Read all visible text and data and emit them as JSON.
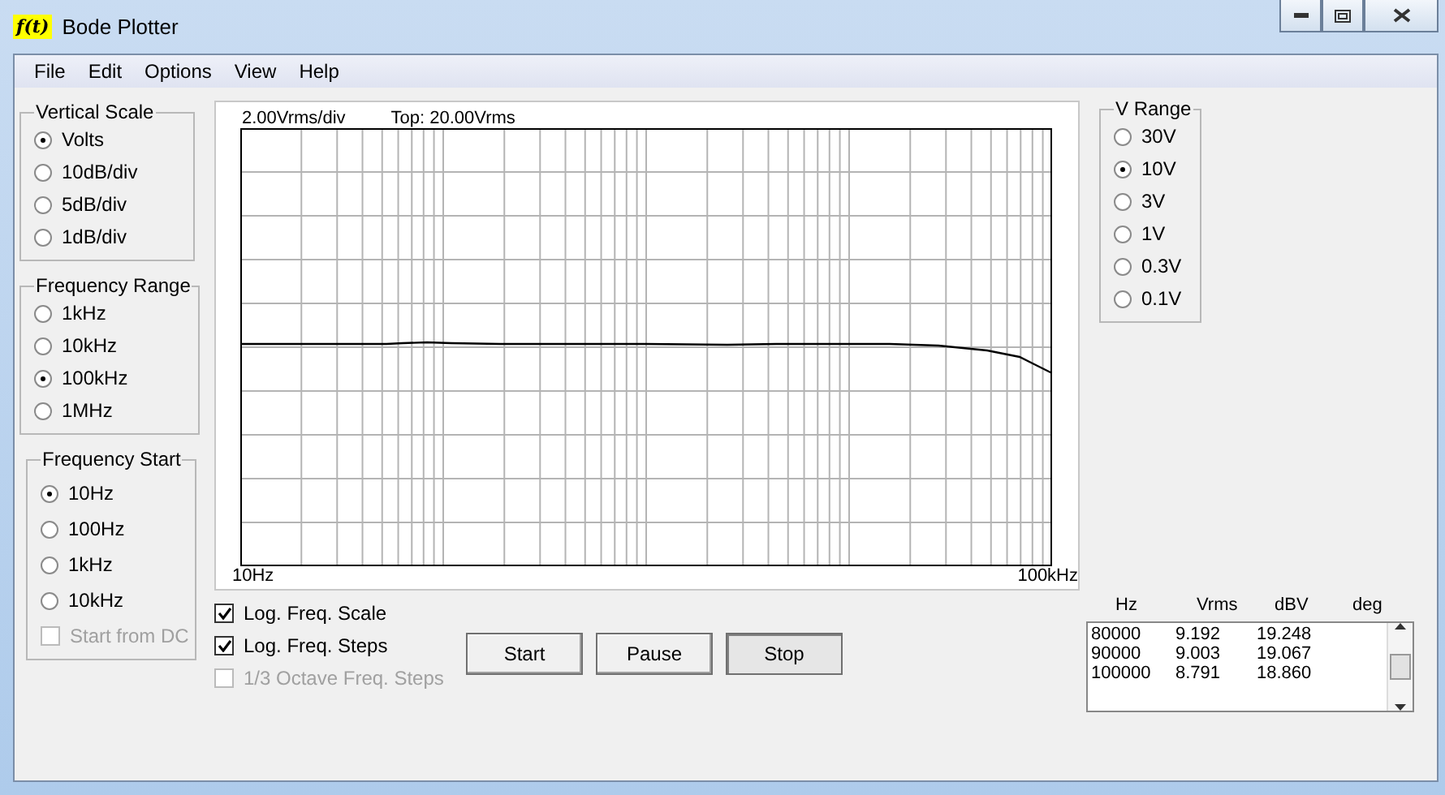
{
  "window": {
    "logo": "f(t)",
    "title": "Bode Plotter"
  },
  "menu": [
    "File",
    "Edit",
    "Options",
    "View",
    "Help"
  ],
  "vertical_scale": {
    "title": "Vertical Scale",
    "options": [
      {
        "label": "Volts",
        "selected": true
      },
      {
        "label": "10dB/div",
        "selected": false
      },
      {
        "label": "5dB/div",
        "selected": false
      },
      {
        "label": "1dB/div",
        "selected": false
      }
    ]
  },
  "frequency_range": {
    "title": "Frequency Range",
    "options": [
      {
        "label": "1kHz",
        "selected": false
      },
      {
        "label": "10kHz",
        "selected": false
      },
      {
        "label": "100kHz",
        "selected": true
      },
      {
        "label": "1MHz",
        "selected": false
      }
    ]
  },
  "frequency_start": {
    "title": "Frequency Start",
    "options": [
      {
        "label": "10Hz",
        "selected": true
      },
      {
        "label": "100Hz",
        "selected": false
      },
      {
        "label": "1kHz",
        "selected": false
      },
      {
        "label": "10kHz",
        "selected": false
      }
    ],
    "start_from_dc": {
      "label": "Start from DC",
      "checked": false,
      "disabled": true
    }
  },
  "plot": {
    "scale_label": "2.00Vrms/div",
    "top_label": "Top: 20.00Vrms",
    "x_start": "10Hz",
    "x_end": "100kHz"
  },
  "v_range": {
    "title": "V Range",
    "options": [
      {
        "label": "30V",
        "selected": false
      },
      {
        "label": "10V",
        "selected": true
      },
      {
        "label": "3V",
        "selected": false
      },
      {
        "label": "1V",
        "selected": false
      },
      {
        "label": "0.3V",
        "selected": false
      },
      {
        "label": "0.1V",
        "selected": false
      }
    ]
  },
  "checkboxes": [
    {
      "label": "Log. Freq. Scale",
      "checked": true,
      "disabled": false
    },
    {
      "label": "Log. Freq. Steps",
      "checked": true,
      "disabled": false
    },
    {
      "label": "1/3 Octave Freq. Steps",
      "checked": false,
      "disabled": true
    }
  ],
  "buttons": [
    {
      "label": "Start",
      "pressed": false
    },
    {
      "label": "Pause",
      "pressed": false
    },
    {
      "label": "Stop",
      "pressed": true
    }
  ],
  "readings": {
    "columns": [
      "Hz",
      "Vrms",
      "dBV",
      "deg"
    ],
    "rows": [
      [
        "80000",
        "9.192",
        "19.248"
      ],
      [
        "90000",
        "9.003",
        "19.067"
      ],
      [
        "100000",
        "8.791",
        "18.860"
      ]
    ]
  }
}
